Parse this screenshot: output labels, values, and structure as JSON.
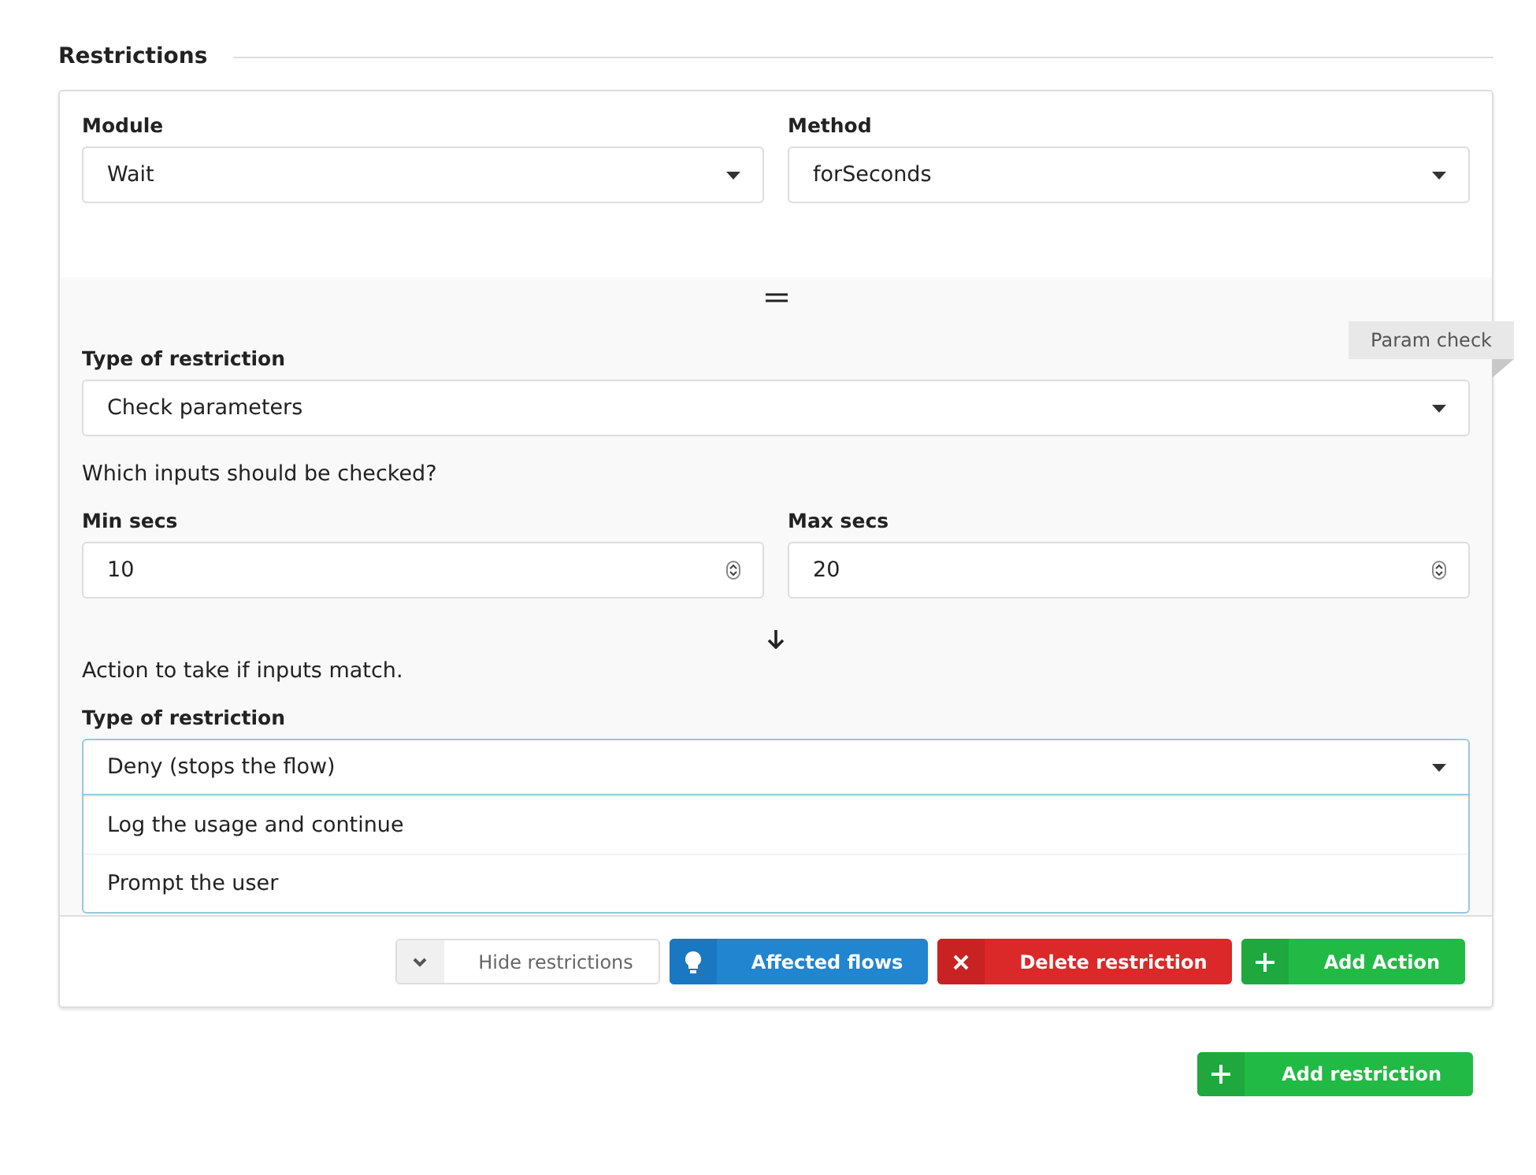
{
  "section": {
    "title": "Restrictions"
  },
  "selectors": [
    {
      "label": "Module",
      "value": "Wait"
    },
    {
      "label": "Method",
      "value": "forSeconds"
    }
  ],
  "ribbon": "Param check",
  "restriction_type": {
    "label": "Type of restriction",
    "value": "Check parameters"
  },
  "inputs_prompt": "Which inputs should be checked?",
  "params": [
    {
      "label": "Min secs",
      "value": "10"
    },
    {
      "label": "Max secs",
      "value": "20"
    }
  ],
  "action_prompt": "Action to take if inputs match.",
  "action_type": {
    "label": "Type of restriction",
    "value": "Deny (stops the flow)",
    "expanded": true,
    "options": [
      "Log the usage and continue",
      "Prompt the user"
    ]
  },
  "buttons": [
    {
      "kind": "toggle",
      "label": "Hide restrictions"
    },
    {
      "kind": "info",
      "label": "Affected flows"
    },
    {
      "kind": "delete",
      "label": "Delete restriction"
    },
    {
      "kind": "add",
      "label": "Add Action"
    }
  ],
  "add_button": {
    "kind": "add",
    "label": "Add restriction"
  }
}
